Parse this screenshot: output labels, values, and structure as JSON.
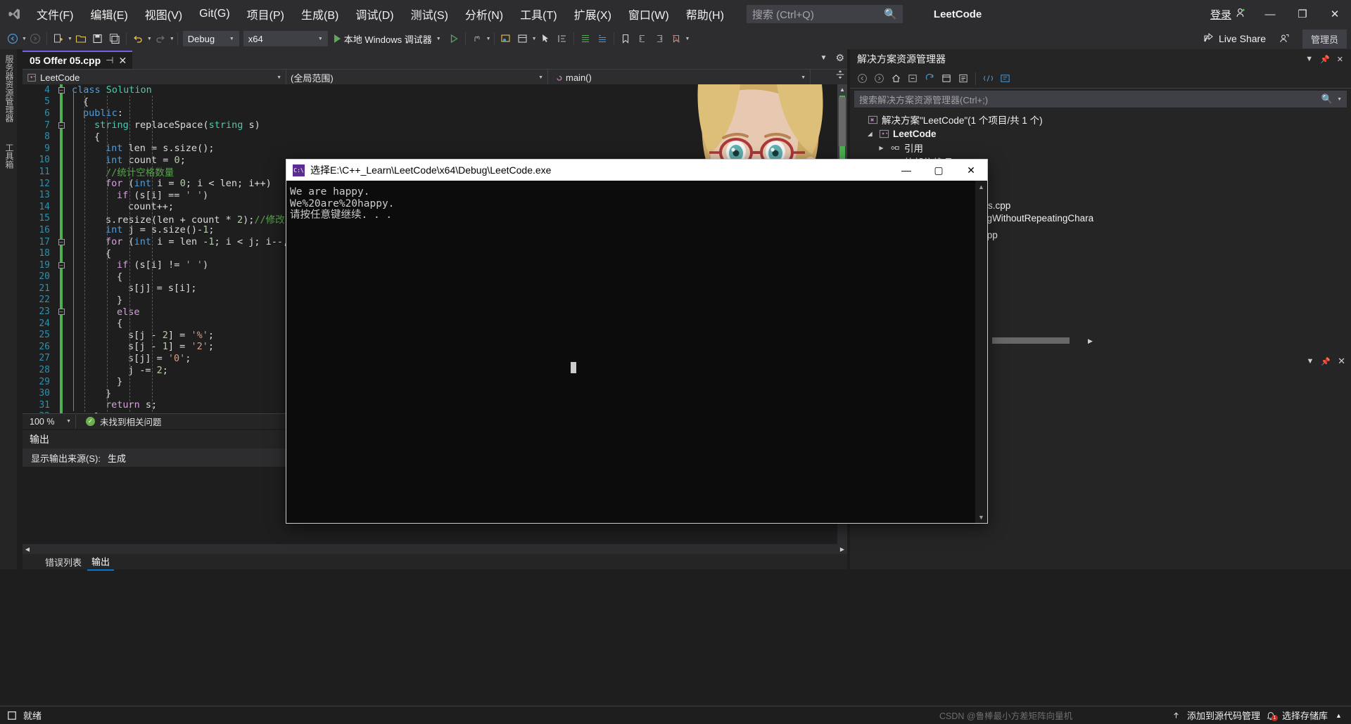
{
  "titlebar": {
    "app_icon": "visual-studio-logo",
    "menus": [
      "文件(F)",
      "编辑(E)",
      "视图(V)",
      "Git(G)",
      "项目(P)",
      "生成(B)",
      "调试(D)",
      "测试(S)",
      "分析(N)",
      "工具(T)",
      "扩展(X)",
      "窗口(W)",
      "帮助(H)"
    ],
    "search_placeholder": "搜索 (Ctrl+Q)",
    "search_icon": "magnifier-icon",
    "solution_title": "LeetCode",
    "signin_label": "登录",
    "signin_icon": "account-add-icon",
    "minimize": "—",
    "maximize": "❐",
    "close": "✕"
  },
  "toolbar": {
    "config_value": "Debug",
    "platform_value": "x64",
    "run_label": "本地 Windows 调试器",
    "live_share_label": "Live Share",
    "live_share_icon": "share-icon",
    "admin_label": "管理员",
    "back_icon": "back-arrow-icon",
    "forward_icon": "forward-arrow-icon",
    "new_icon": "new-item-icon",
    "open_icon": "open-folder-icon",
    "save_icon": "save-icon",
    "saveall_icon": "save-all-icon",
    "undo_icon": "undo-icon",
    "redo_icon": "redo-icon"
  },
  "left_tabs": [
    "服务器资源管理器",
    "工具箱"
  ],
  "editor": {
    "tab_name": "05 Offer 05.cpp",
    "pin_icon": "pin-icon",
    "close_icon": "close-icon",
    "project_scope": "LeetCode",
    "global_scope": "(全局范围)",
    "function_scope": "main()",
    "scope_icon": "cpp-project-icon",
    "method_icon": "method-icon",
    "lines": [
      {
        "num": "4",
        "fold": "minus",
        "indent": 0,
        "tokens": [
          {
            "t": "class ",
            "c": "k"
          },
          {
            "t": "Solution",
            "c": "t"
          }
        ]
      },
      {
        "num": "5",
        "fold": "",
        "indent": 1,
        "tokens": [
          {
            "t": "{",
            "c": "p"
          }
        ]
      },
      {
        "num": "6",
        "fold": "",
        "indent": 1,
        "tokens": [
          {
            "t": "public",
            "c": "k"
          },
          {
            "t": ":",
            "c": "p"
          }
        ]
      },
      {
        "num": "7",
        "fold": "minus",
        "indent": 2,
        "tokens": [
          {
            "t": "string ",
            "c": "t"
          },
          {
            "t": "replaceSpace",
            "c": "p"
          },
          {
            "t": "(",
            "c": "p"
          },
          {
            "t": "string",
            "c": "t"
          },
          {
            "t": " s)",
            "c": "p"
          }
        ]
      },
      {
        "num": "8",
        "fold": "",
        "indent": 2,
        "tokens": [
          {
            "t": "{",
            "c": "p"
          }
        ]
      },
      {
        "num": "9",
        "fold": "",
        "indent": 3,
        "tokens": [
          {
            "t": "int",
            "c": "k"
          },
          {
            "t": " len = s.",
            "c": "p"
          },
          {
            "t": "size",
            "c": "p"
          },
          {
            "t": "();",
            "c": "p"
          }
        ]
      },
      {
        "num": "10",
        "fold": "",
        "indent": 3,
        "tokens": [
          {
            "t": "int",
            "c": "k"
          },
          {
            "t": " count = ",
            "c": "p"
          },
          {
            "t": "0",
            "c": "n"
          },
          {
            "t": ";",
            "c": "p"
          }
        ]
      },
      {
        "num": "11",
        "fold": "",
        "indent": 3,
        "tokens": [
          {
            "t": "//统计空格数量",
            "c": "cm"
          }
        ]
      },
      {
        "num": "12",
        "fold": "",
        "indent": 3,
        "tokens": [
          {
            "t": "for",
            "c": "kc"
          },
          {
            "t": " (",
            "c": "p"
          },
          {
            "t": "int",
            "c": "k"
          },
          {
            "t": " i = ",
            "c": "p"
          },
          {
            "t": "0",
            "c": "n"
          },
          {
            "t": "; i < len; i++)",
            "c": "p"
          }
        ]
      },
      {
        "num": "13",
        "fold": "",
        "indent": 4,
        "tokens": [
          {
            "t": "if",
            "c": "kc"
          },
          {
            "t": " (s[i] == ",
            "c": "p"
          },
          {
            "t": "' '",
            "c": "s"
          },
          {
            "t": ")",
            "c": "p"
          }
        ]
      },
      {
        "num": "14",
        "fold": "",
        "indent": 5,
        "tokens": [
          {
            "t": "count++;",
            "c": "p"
          }
        ]
      },
      {
        "num": "15",
        "fold": "",
        "indent": 3,
        "tokens": [
          {
            "t": "s.resize(len + count * ",
            "c": "p"
          },
          {
            "t": "2",
            "c": "n"
          },
          {
            "t": ");",
            "c": "p"
          },
          {
            "t": "//修改s长",
            "c": "cm"
          }
        ]
      },
      {
        "num": "16",
        "fold": "",
        "indent": 3,
        "tokens": [
          {
            "t": "int",
            "c": "k"
          },
          {
            "t": " j = s.size()-",
            "c": "p"
          },
          {
            "t": "1",
            "c": "n"
          },
          {
            "t": ";",
            "c": "p"
          }
        ]
      },
      {
        "num": "17",
        "fold": "minus",
        "indent": 3,
        "tokens": [
          {
            "t": "for",
            "c": "kc"
          },
          {
            "t": " (",
            "c": "p"
          },
          {
            "t": "int",
            "c": "k"
          },
          {
            "t": " i = len -",
            "c": "p"
          },
          {
            "t": "1",
            "c": "n"
          },
          {
            "t": "; i < j; i--,j--",
            "c": "p"
          }
        ]
      },
      {
        "num": "18",
        "fold": "",
        "indent": 3,
        "tokens": [
          {
            "t": "{",
            "c": "p"
          }
        ]
      },
      {
        "num": "19",
        "fold": "minus",
        "indent": 4,
        "tokens": [
          {
            "t": "if",
            "c": "kc"
          },
          {
            "t": " (s[i] != ",
            "c": "p"
          },
          {
            "t": "' '",
            "c": "s"
          },
          {
            "t": ")",
            "c": "p"
          }
        ]
      },
      {
        "num": "20",
        "fold": "",
        "indent": 4,
        "tokens": [
          {
            "t": "{",
            "c": "p"
          }
        ]
      },
      {
        "num": "21",
        "fold": "",
        "indent": 5,
        "tokens": [
          {
            "t": "s[j] = s[i];",
            "c": "p"
          }
        ]
      },
      {
        "num": "22",
        "fold": "",
        "indent": 4,
        "tokens": [
          {
            "t": "}",
            "c": "p"
          }
        ]
      },
      {
        "num": "23",
        "fold": "minus",
        "indent": 4,
        "tokens": [
          {
            "t": "else",
            "c": "kc"
          }
        ]
      },
      {
        "num": "24",
        "fold": "",
        "indent": 4,
        "tokens": [
          {
            "t": "{",
            "c": "p"
          }
        ]
      },
      {
        "num": "25",
        "fold": "",
        "indent": 5,
        "tokens": [
          {
            "t": "s[j - ",
            "c": "p"
          },
          {
            "t": "2",
            "c": "n"
          },
          {
            "t": "] = ",
            "c": "p"
          },
          {
            "t": "'%'",
            "c": "s"
          },
          {
            "t": ";",
            "c": "p"
          }
        ]
      },
      {
        "num": "26",
        "fold": "",
        "indent": 5,
        "tokens": [
          {
            "t": "s[j - ",
            "c": "p"
          },
          {
            "t": "1",
            "c": "n"
          },
          {
            "t": "] = ",
            "c": "p"
          },
          {
            "t": "'2'",
            "c": "s"
          },
          {
            "t": ";",
            "c": "p"
          }
        ]
      },
      {
        "num": "27",
        "fold": "",
        "indent": 5,
        "tokens": [
          {
            "t": "s[j] = ",
            "c": "p"
          },
          {
            "t": "'0'",
            "c": "s"
          },
          {
            "t": ";",
            "c": "p"
          }
        ]
      },
      {
        "num": "28",
        "fold": "",
        "indent": 5,
        "tokens": [
          {
            "t": "j -= ",
            "c": "p"
          },
          {
            "t": "2",
            "c": "n"
          },
          {
            "t": ";",
            "c": "p"
          }
        ]
      },
      {
        "num": "29",
        "fold": "",
        "indent": 4,
        "tokens": [
          {
            "t": "}",
            "c": "p"
          }
        ]
      },
      {
        "num": "30",
        "fold": "",
        "indent": 3,
        "tokens": [
          {
            "t": "}",
            "c": "p"
          }
        ]
      },
      {
        "num": "31",
        "fold": "",
        "indent": 3,
        "tokens": [
          {
            "t": "return",
            "c": "kc"
          },
          {
            "t": " s;",
            "c": "p"
          }
        ]
      },
      {
        "num": "32",
        "fold": "",
        "indent": 2,
        "tokens": [
          {
            "t": "}",
            "c": "p"
          }
        ]
      }
    ]
  },
  "editor_status": {
    "zoom": "100 %",
    "issues": "未找到相关问题",
    "ok_icon": "check-circle-icon"
  },
  "output": {
    "title": "输出",
    "source_label": "显示输出来源(S):",
    "source_value": "生成",
    "tabs": [
      {
        "label": "错误列表",
        "active": false
      },
      {
        "label": "输出",
        "active": true
      }
    ]
  },
  "solution_explorer": {
    "title": "解决方案资源管理器",
    "dropdown_icon": "chevron-down-icon",
    "pin_icon": "pin-icon",
    "close_icon": "close-icon",
    "search_placeholder": "搜索解决方案资源管理器(Ctrl+;)",
    "search_icon": "magnifier-icon",
    "toolbar_icons": [
      "back-arrow-icon",
      "forward-arrow-icon",
      "home-icon",
      "refresh-icon",
      "collapse-all-icon",
      "sync-icon",
      "properties-icon",
      "show-all-files-icon",
      "preview-icon",
      "filter-icon"
    ],
    "tree": [
      {
        "indent": 0,
        "arrow": "",
        "icon": "solution-icon",
        "label": "解决方案\"LeetCode\"(1 个项目/共 1 个)",
        "bold": false
      },
      {
        "indent": 1,
        "arrow": "down",
        "icon": "cpp-project-icon",
        "label": "LeetCode",
        "bold": true
      },
      {
        "indent": 2,
        "arrow": "right",
        "icon": "references-icon",
        "label": "引用",
        "bold": false
      },
      {
        "indent": 2,
        "arrow": "right",
        "icon": "folder-icon",
        "label": "外部依赖项",
        "bold": false
      }
    ],
    "partial_files": [
      "ers.cpp",
      "ingWithoutRepeatingChara",
      "cpp"
    ]
  },
  "console_window": {
    "icon": "cmd-icon",
    "title": "选择E:\\C++_Learn\\LeetCode\\x64\\Debug\\LeetCode.exe",
    "minimize": "—",
    "maximize": "▢",
    "close": "✕",
    "output_lines": [
      "We are happy.",
      "We%20are%20happy.",
      "请按任意键继续. . ."
    ],
    "scroll_up_icon": "chevron-up-icon",
    "scroll_down_icon": "chevron-down-icon"
  },
  "statusbar": {
    "ready_label": "就绪",
    "ready_icon": "stop-icon",
    "source_label": "添加到源代码管理",
    "select_repo_label": "选择存储库",
    "bell_icon": "bell-icon",
    "bell_count": "1",
    "up_arrow_icon": "up-arrow-icon",
    "watermark": "CSDN @鲁棒最小方差矩阵向量机"
  }
}
